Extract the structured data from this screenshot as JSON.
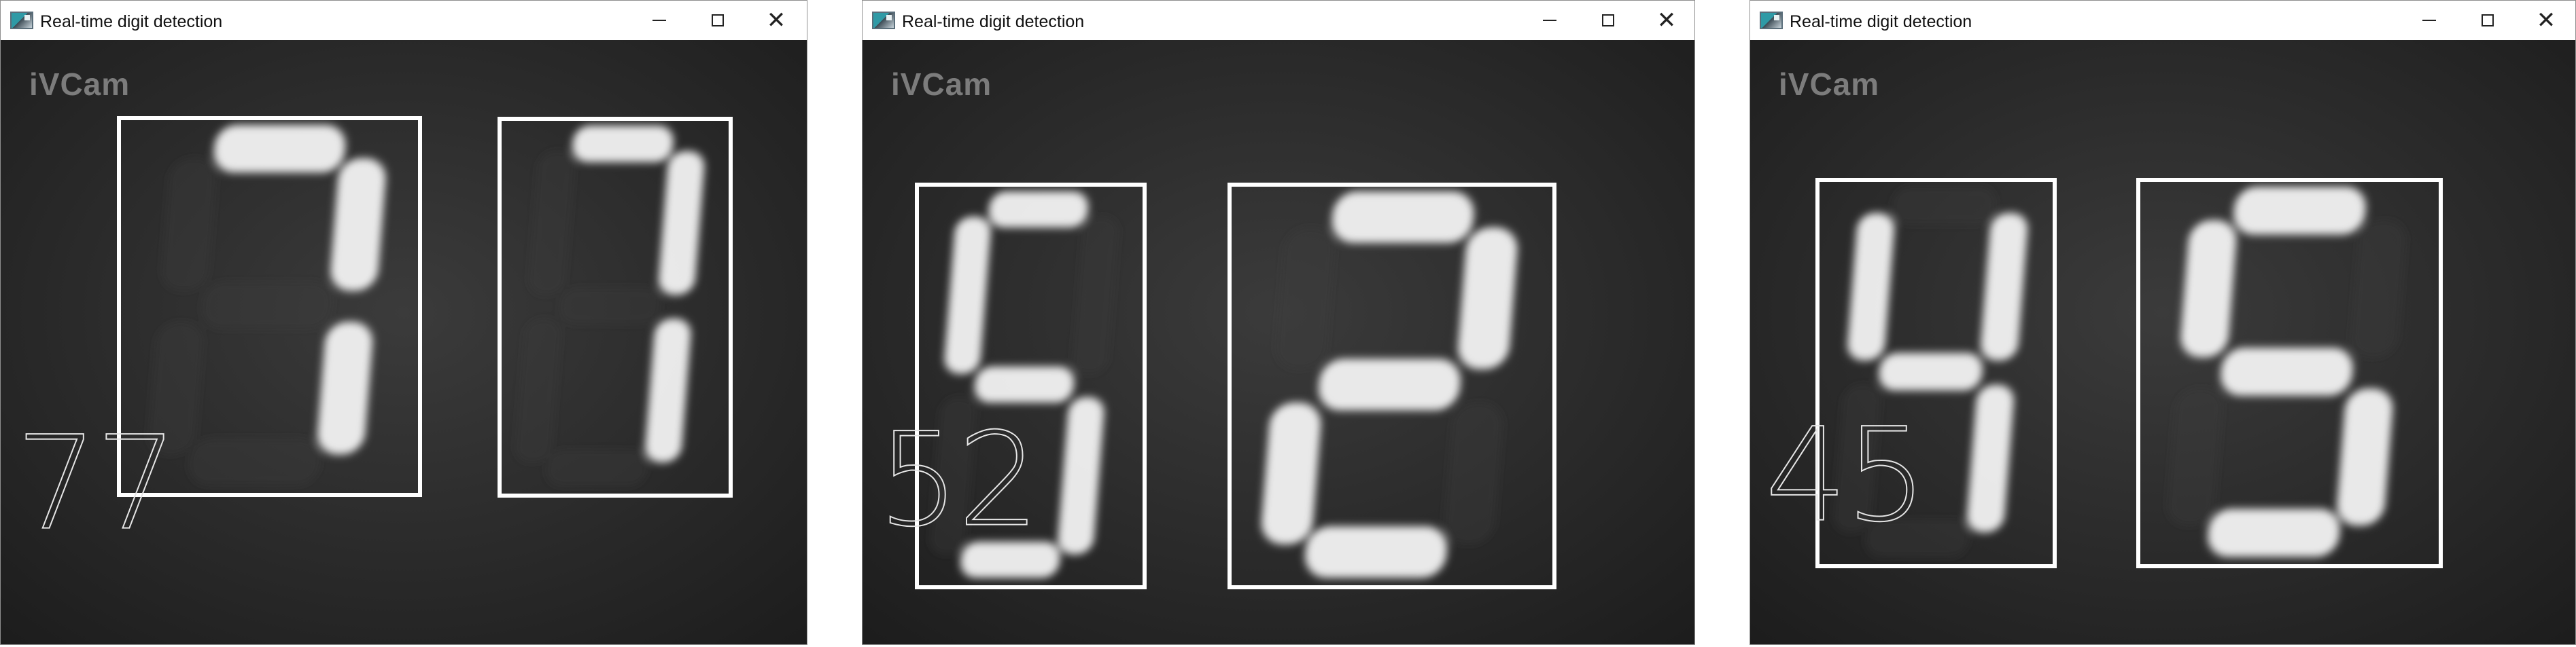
{
  "windows": [
    {
      "title": "Real-time digit detection",
      "watermark": "iVCam",
      "prediction": [
        "7",
        "7"
      ],
      "controls": {
        "minimize": "minimize-icon",
        "maximize": "maximize-icon",
        "close": "close-icon"
      }
    },
    {
      "title": "Real-time digit detection",
      "watermark": "iVCam",
      "prediction": [
        "5",
        "2"
      ],
      "controls": {
        "minimize": "minimize-icon",
        "maximize": "maximize-icon",
        "close": "close-icon"
      }
    },
    {
      "title": "Real-time digit detection",
      "watermark": "iVCam",
      "prediction": [
        "4",
        "5"
      ],
      "controls": {
        "minimize": "minimize-icon",
        "maximize": "maximize-icon",
        "close": "close-icon"
      }
    }
  ],
  "colors": {
    "feed_background": "#2b2b2b",
    "segment_on": "#f2f2f2",
    "box": "#ffffff"
  }
}
